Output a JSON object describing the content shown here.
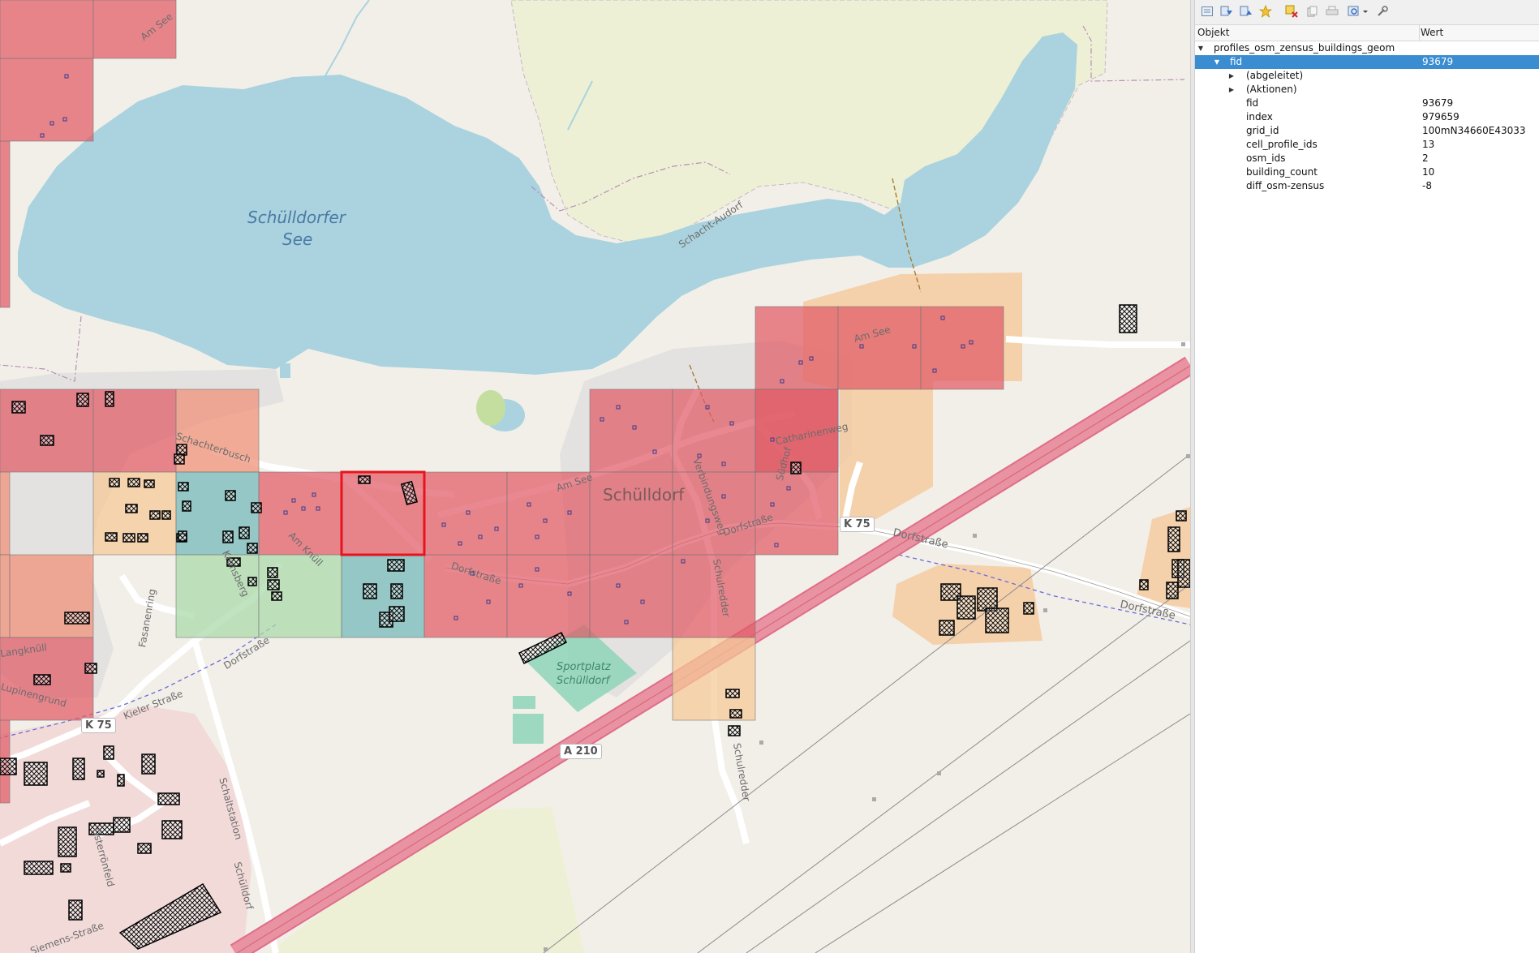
{
  "panel": {
    "toolbar_icons": [
      "identify-mode-icon",
      "expand-tree-icon",
      "collapse-tree-icon",
      "expand-new-results-icon",
      "clear-results-icon",
      "copy-feature-icon",
      "print-icon",
      "identify-settings-icon",
      "help-icon"
    ],
    "columns": {
      "object": "Objekt",
      "value": "Wert"
    },
    "layer_name": "profiles_osm_zensus_buildings_geom",
    "feature": {
      "key": "fid",
      "value": "93679"
    },
    "groups": [
      "(abgeleitet)",
      "(Aktionen)"
    ],
    "attributes": [
      {
        "name": "fid",
        "value": "93679"
      },
      {
        "name": "index",
        "value": "979659"
      },
      {
        "name": "grid_id",
        "value": "100mN34660E43033"
      },
      {
        "name": "cell_profile_ids",
        "value": "13"
      },
      {
        "name": "osm_ids",
        "value": "2"
      },
      {
        "name": "building_count",
        "value": "10"
      },
      {
        "name": "diff_osm-zensus",
        "value": "-8"
      }
    ]
  },
  "map": {
    "lake_name_line1": "Schülldorfer",
    "lake_name_line2": "See",
    "village": "Schülldorf",
    "sports_line1": "Sportplatz",
    "sports_line2": "Schülldorf",
    "streets": {
      "am_see_1": "Am See",
      "am_see_2": "Am See",
      "am_see_3": "Am See",
      "schacht_audorf": "Schacht-Audorf",
      "schachterbusch": "Schachterbusch",
      "catharinenweg": "Catharinenweg",
      "dorfstrasse_1": "Dorfstraße",
      "dorfstrasse_2": "Dorfstraße",
      "dorfstrasse_3": "Dorfstraße",
      "dorfstrasse_4": "Dorfstraße",
      "dorfstrasse_5": "Dorfstraße",
      "verbindungsweg": "Verbindungsweg",
      "schulredder_1": "Schulredder",
      "schulredder_2": "Schulredder",
      "suedhof": "Südhof",
      "am_knuell": "Am Knüll",
      "kronsberg": "Kronsberg",
      "fasanenring": "Fasanenring",
      "kieler_strasse": "Kieler Straße",
      "lupinengrund": "Lupinengrund",
      "langknuell": "Langknüll",
      "schaltstation": "Schaltstation",
      "schuelldorf": "Schülldorf",
      "osterronfeld": "Osterrönfeld",
      "siemens_strasse": "Siemens-Straße"
    },
    "road_shields": {
      "k75_a": "K 75",
      "k75_b": "K 75",
      "a210": "A 210"
    },
    "colors": {
      "lake": "#aad3df",
      "farmland": "#eef0d5",
      "red_cell": "#e05a65",
      "salmon_cell": "#ee8f74",
      "orange_cell": "#f5c796",
      "teal_cell": "#6fb7b7",
      "green_cell": "#a8d8a8",
      "highlight": "#e8141d",
      "motorway": "#e892a2",
      "selection": "#3a8dd1"
    }
  }
}
